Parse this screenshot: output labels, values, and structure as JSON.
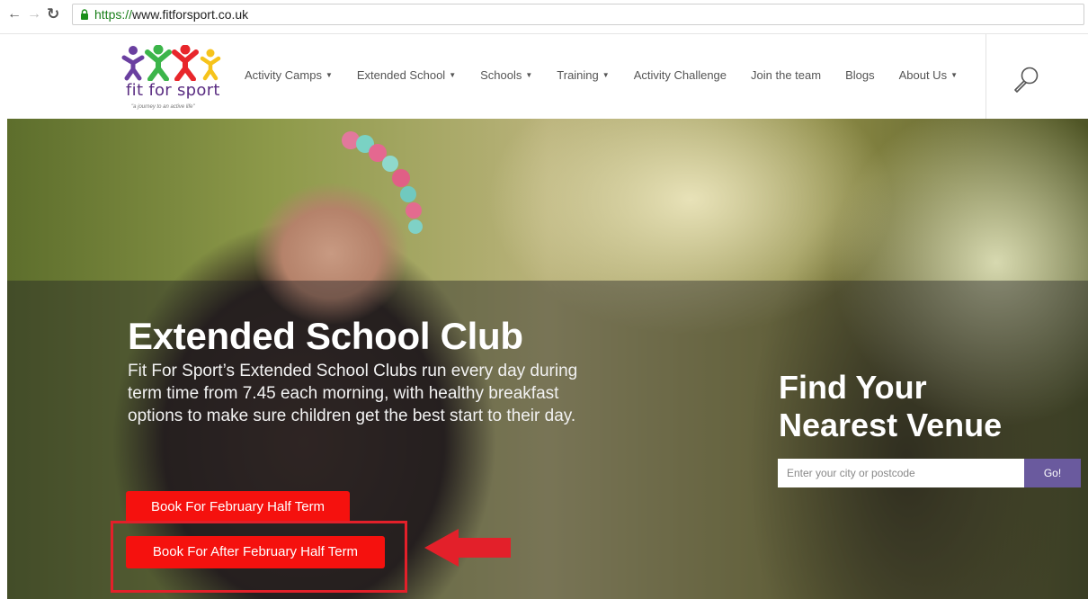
{
  "browser": {
    "url_scheme": "https://",
    "url_rest": "www.fitforsport.co.uk",
    "icons": [
      "back-arrow-icon",
      "forward-arrow-icon",
      "reload-icon",
      "lock-icon"
    ]
  },
  "logo": {
    "name": "fit for sport",
    "tagline": "\"a journey to an active life\"",
    "figure_colors": [
      "#6a3fa0",
      "#3cb54a",
      "#e8262b",
      "#f6c31b"
    ]
  },
  "nav": {
    "items": [
      {
        "label": "Activity Camps",
        "dropdown": true
      },
      {
        "label": "Extended School",
        "dropdown": true
      },
      {
        "label": "Schools",
        "dropdown": true
      },
      {
        "label": "Training",
        "dropdown": true
      },
      {
        "label": "Activity Challenge",
        "dropdown": false
      },
      {
        "label": "Join the team",
        "dropdown": false
      },
      {
        "label": "Blogs",
        "dropdown": false
      },
      {
        "label": "About Us",
        "dropdown": true
      }
    ],
    "search_icon": "search-icon"
  },
  "hero": {
    "title": "Extended School Club",
    "description": "Fit For Sport’s Extended School Clubs run every day during term time from 7.45 each morning, with healthy breakfast options to make sure children get the best start to their day.",
    "button_1": "Book For February Half Term",
    "button_2": "Book For After February Half Term"
  },
  "venue": {
    "title_line1": "Find Your",
    "title_line2": "Nearest Venue",
    "input_value": "",
    "input_placeholder": "Enter your city or postcode",
    "go_label": "Go!"
  },
  "colors": {
    "button_red": "#f5110e",
    "highlight_red": "#e3202a",
    "go_purple": "#6a5a9e",
    "logo_purple": "#5a2d82"
  }
}
